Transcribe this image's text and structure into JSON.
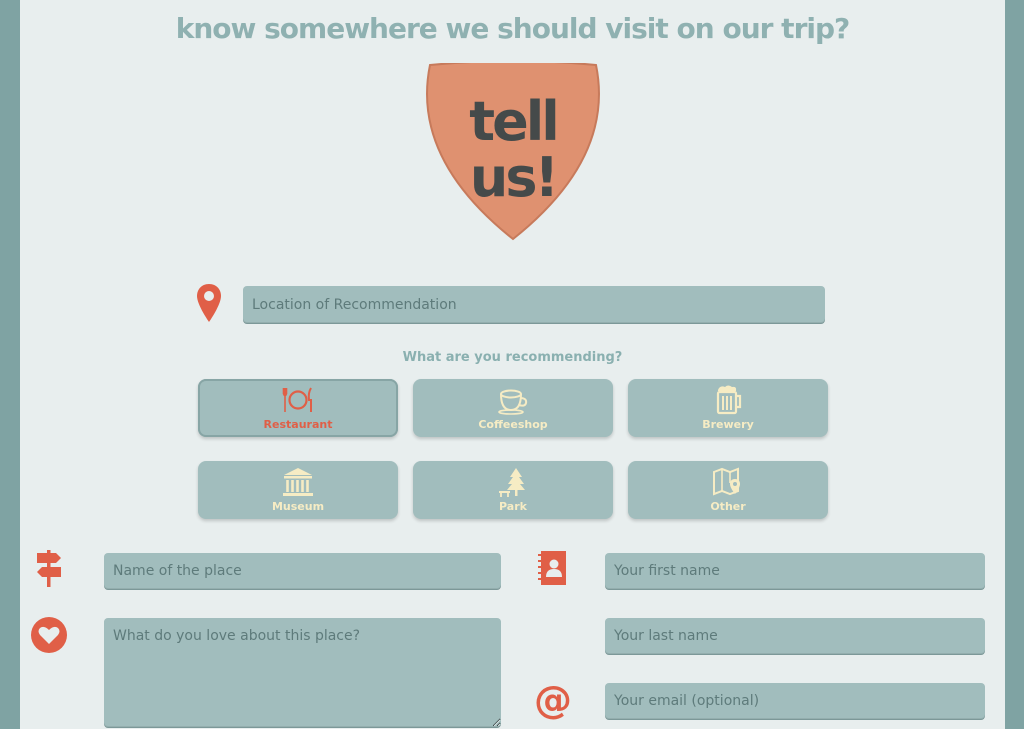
{
  "header": {
    "headline": "know somewhere we should visit on our trip?",
    "badge_line1": "tell",
    "badge_line2": "us!"
  },
  "location": {
    "placeholder": "Location of Recommendation"
  },
  "categories": {
    "question": "What are you recommending?",
    "items": [
      {
        "label": "Restaurant",
        "icon": "fork-plate-knife-icon",
        "selected": true
      },
      {
        "label": "Coffeeshop",
        "icon": "coffee-cup-icon",
        "selected": false
      },
      {
        "label": "Brewery",
        "icon": "beer-mug-icon",
        "selected": false
      },
      {
        "label": "Museum",
        "icon": "museum-building-icon",
        "selected": false
      },
      {
        "label": "Park",
        "icon": "tree-bench-icon",
        "selected": false
      },
      {
        "label": "Other",
        "icon": "map-pin-icon",
        "selected": false
      }
    ]
  },
  "place": {
    "name_placeholder": "Name of the place",
    "love_placeholder": "What do you love about this place?"
  },
  "contact": {
    "first_placeholder": "Your first name",
    "last_placeholder": "Your last name",
    "email_placeholder": "Your email (optional)"
  },
  "colors": {
    "accent": "#e05f47",
    "shield": "#df9170",
    "field": "#a1bdbd",
    "background": "#e8eeee",
    "frame": "#7fa3a3",
    "label_cream": "#f6ecc4"
  }
}
